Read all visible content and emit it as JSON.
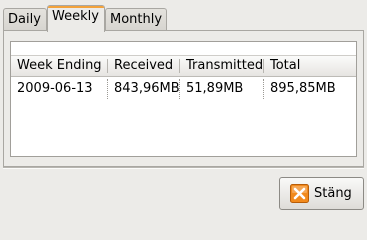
{
  "tabs": [
    {
      "label": "Daily",
      "active": false
    },
    {
      "label": "Weekly",
      "active": true
    },
    {
      "label": "Monthly",
      "active": false
    }
  ],
  "table": {
    "columns": [
      "Week Ending",
      "Received",
      "Transmitted",
      "Total"
    ],
    "rows": [
      [
        "2009-06-13",
        "843,96MB",
        "51,89MB",
        "895,85MB"
      ]
    ]
  },
  "close_button": {
    "label": "Stäng",
    "icon": "close-icon"
  },
  "colors": {
    "window_bg": "#ecebe8",
    "active_tab_accent": "#f3a23a",
    "close_icon_bg": "#f28a1c"
  }
}
